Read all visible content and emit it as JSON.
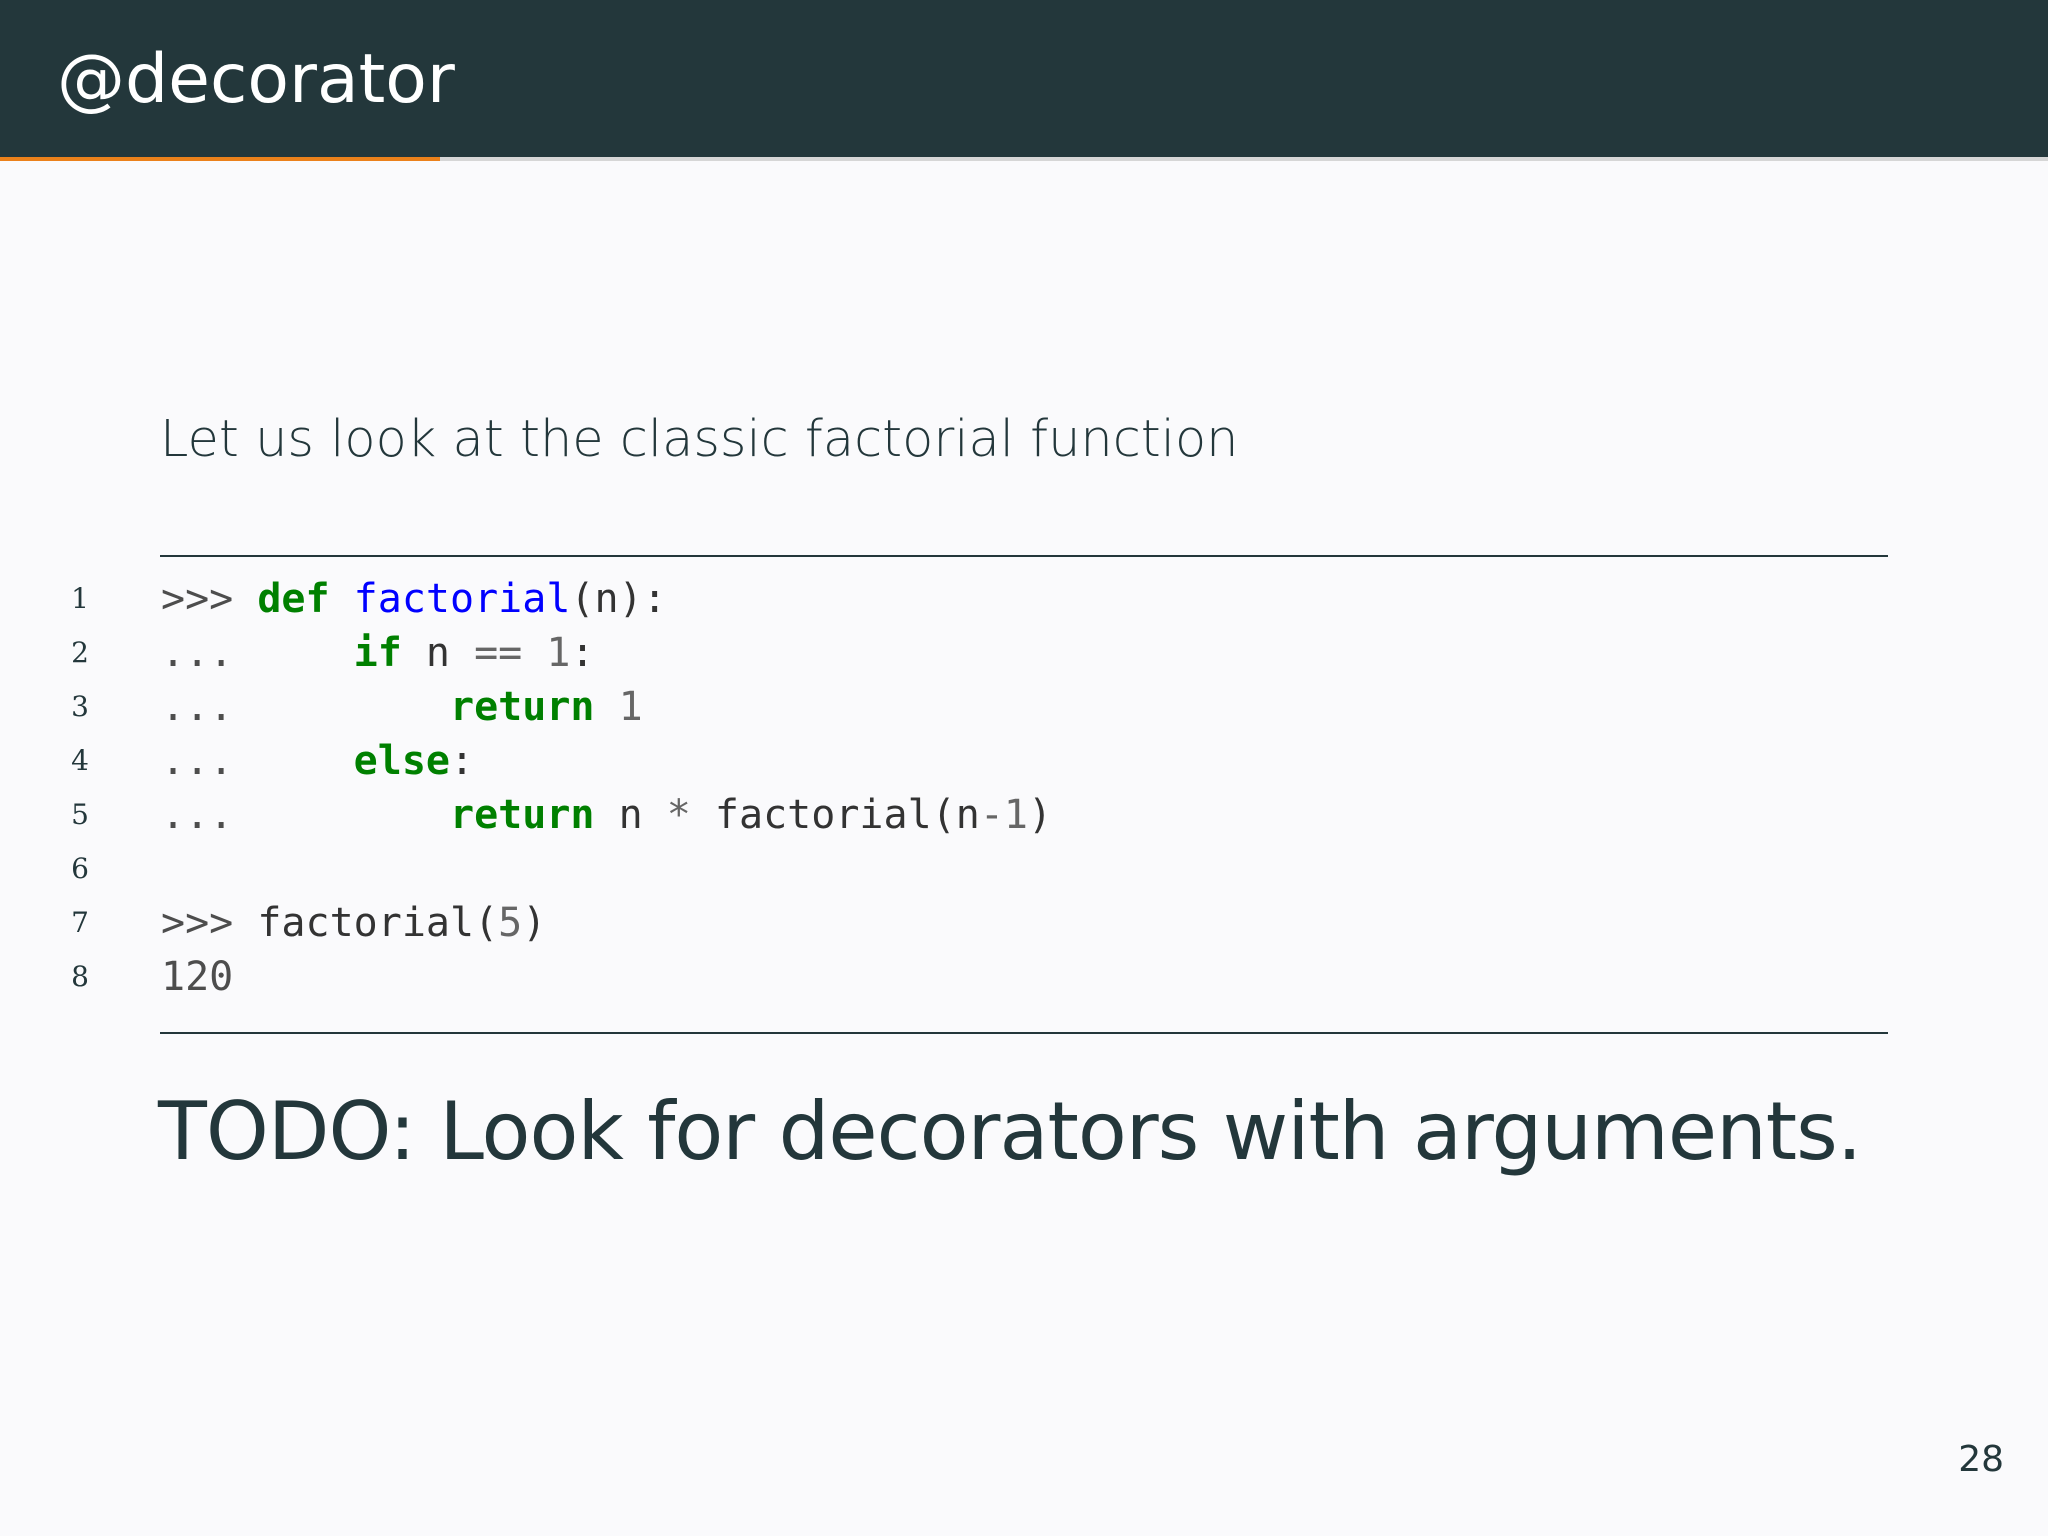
{
  "slide": {
    "title": "@decorator",
    "progress_fraction": 0.215,
    "intro": "Let us look at the classic factorial function",
    "todo": "TODO: Look for decorators with arguments.",
    "page_number": "28"
  },
  "code": {
    "line_numbers": [
      "1",
      "2",
      "3",
      "4",
      "5",
      "6",
      "7",
      "8"
    ],
    "lines": [
      [
        {
          "t": ">>> ",
          "c": "gp"
        },
        {
          "t": "def",
          "c": "kw"
        },
        {
          "t": " "
        },
        {
          "t": "factorial",
          "c": "fn"
        },
        {
          "t": "(n):"
        }
      ],
      [
        {
          "t": "... ",
          "c": "gp"
        },
        {
          "t": "    "
        },
        {
          "t": "if",
          "c": "kw"
        },
        {
          "t": " n "
        },
        {
          "t": "==",
          "c": "op"
        },
        {
          "t": " "
        },
        {
          "t": "1",
          "c": "num"
        },
        {
          "t": ":"
        }
      ],
      [
        {
          "t": "... ",
          "c": "gp"
        },
        {
          "t": "        "
        },
        {
          "t": "return",
          "c": "kw"
        },
        {
          "t": " "
        },
        {
          "t": "1",
          "c": "num"
        }
      ],
      [
        {
          "t": "... ",
          "c": "gp"
        },
        {
          "t": "    "
        },
        {
          "t": "else",
          "c": "kw"
        },
        {
          "t": ":"
        }
      ],
      [
        {
          "t": "... ",
          "c": "gp"
        },
        {
          "t": "        "
        },
        {
          "t": "return",
          "c": "kw"
        },
        {
          "t": " n "
        },
        {
          "t": "*",
          "c": "op"
        },
        {
          "t": " factorial(n"
        },
        {
          "t": "-",
          "c": "op"
        },
        {
          "t": "1",
          "c": "num"
        },
        {
          "t": ")"
        }
      ],
      [],
      [
        {
          "t": ">>> ",
          "c": "gp"
        },
        {
          "t": "factorial("
        },
        {
          "t": "5",
          "c": "num"
        },
        {
          "t": ")"
        }
      ],
      [
        {
          "t": "120",
          "c": "gt"
        }
      ]
    ]
  },
  "colors": {
    "header_bg": "#23373b",
    "accent": "#eb811b",
    "keyword": "#008000",
    "function_name": "#0000ff",
    "background": "#fafafc"
  }
}
